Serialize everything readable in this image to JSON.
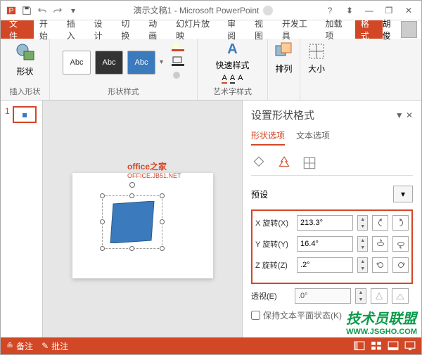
{
  "app": {
    "title": "演示文稿1 - Microsoft PowerPoint",
    "user": "胡俊"
  },
  "qat": [
    "ppt",
    "save",
    "undo",
    "redo",
    "new"
  ],
  "tabs": {
    "file": "文件",
    "items": [
      "开始",
      "插入",
      "设计",
      "切换",
      "动画",
      "幻灯片放映",
      "审阅",
      "视图",
      "开发工具",
      "加载项"
    ],
    "format": "格式"
  },
  "ribbon": {
    "insert_shape": {
      "label": "形状",
      "group": "插入形状"
    },
    "style_group": "形状样式",
    "style_text": "Abc",
    "wordart": {
      "label": "快速样式",
      "group": "艺术字样式"
    },
    "arrange": "排列",
    "size": "大小"
  },
  "thumbs": {
    "num": "1"
  },
  "watermark": {
    "line1": "office之家",
    "line2": "OFFICE.JB51.NET"
  },
  "pane": {
    "title": "设置形状格式",
    "tab_shape": "形状选项",
    "tab_text": "文本选项",
    "preset_label": "预设",
    "x_label": "X 旋转(X)",
    "x_val": "213.3°",
    "y_label": "Y 旋转(Y)",
    "y_val": "16.4°",
    "z_label": "Z 旋转(Z)",
    "z_val": ".2°",
    "persp_label": "透视(E)",
    "persp_val": ".0°",
    "keep_text": "保持文本平面状态(K)"
  },
  "statusbar": {
    "notes": "备注",
    "comments": "批注"
  },
  "corner_wm": {
    "text": "技术员联盟",
    "url": "WWW.JSGHO.COM"
  }
}
